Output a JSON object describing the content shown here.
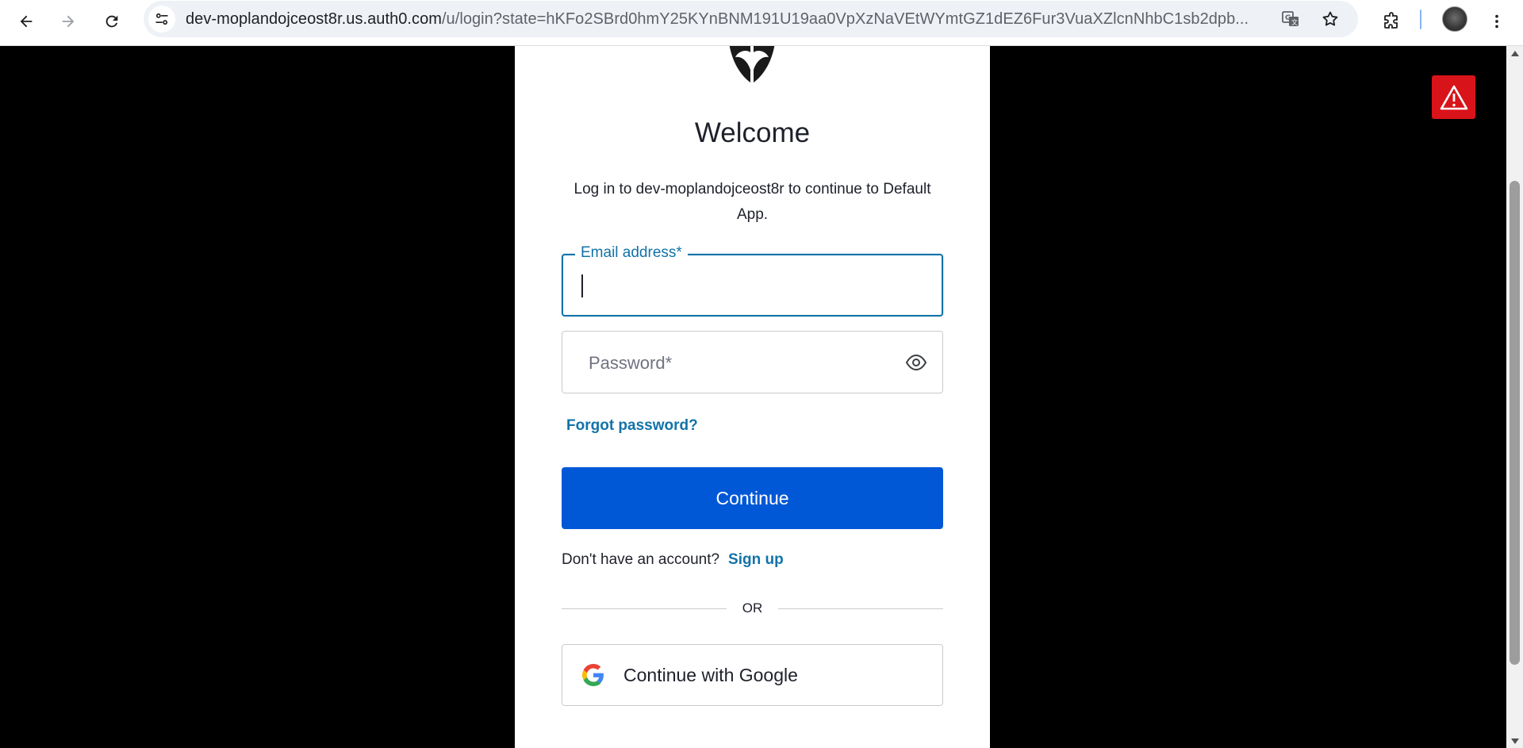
{
  "browser": {
    "url_host": "dev-moplandojceost8r.us.auth0.com",
    "url_path": "/u/login?state=hKFo2SBrd0hmY25KYnBNM191U19aa0VpXzNaVEtWYmtGZ1dEZ6Fur3VuaXZlcnNhbC1sb2dpb...",
    "icons": [
      "back-icon",
      "forward-icon",
      "reload-icon",
      "site-info-icon",
      "translate-icon",
      "bookmark-star-icon",
      "extensions-icon",
      "profile-avatar",
      "menu-kebab-icon"
    ]
  },
  "login": {
    "title": "Welcome",
    "subtitle": "Log in to dev-moplandojceost8r to continue to Default App.",
    "email_label": "Email address*",
    "email_value": "",
    "password_placeholder": "Password*",
    "forgot_password": "Forgot password?",
    "continue_button": "Continue",
    "no_account_text": "Don't have an account?",
    "signup_link": "Sign up",
    "divider_text": "OR",
    "google_button": "Continue with Google"
  },
  "colors": {
    "primary_button": "#0058d6",
    "link": "#1273a8",
    "alert": "#d9131a",
    "page_background": "#000000"
  }
}
